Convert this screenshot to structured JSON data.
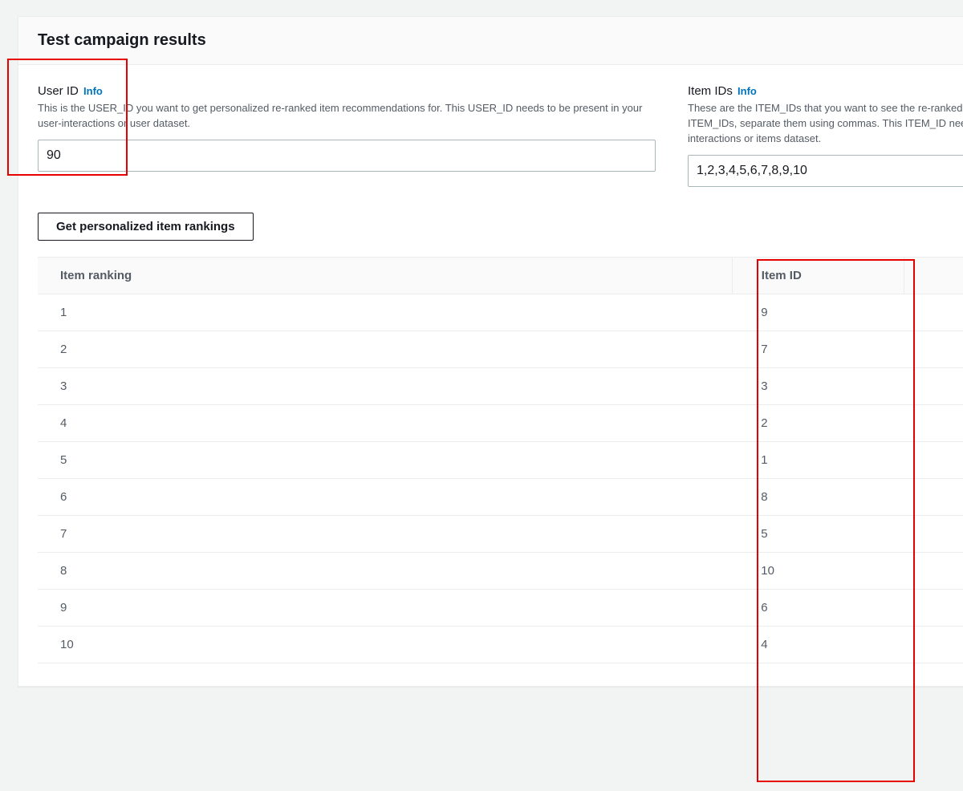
{
  "header": {
    "title": "Test campaign results"
  },
  "user_id": {
    "label": "User ID",
    "info": "Info",
    "help": "This is the USER_ID you want to get personalized re-ranked item recommendations for. This USER_ID needs to be present in your user-interactions or user dataset.",
    "value": "90"
  },
  "item_ids": {
    "label": "Item IDs",
    "info": "Info",
    "help": "These are the ITEM_IDs that you want to see the re-ranked results for. When entering the ITEM_IDs, separate them using commas. This ITEM_ID needs to be present in your interactions or items dataset.",
    "value": "1,2,3,4,5,6,7,8,9,10"
  },
  "action": {
    "label": "Get personalized item rankings"
  },
  "table": {
    "headers": {
      "rank": "Item ranking",
      "item_id": "Item ID"
    },
    "rows": [
      {
        "rank": "1",
        "item_id": "9"
      },
      {
        "rank": "2",
        "item_id": "7"
      },
      {
        "rank": "3",
        "item_id": "3"
      },
      {
        "rank": "4",
        "item_id": "2"
      },
      {
        "rank": "5",
        "item_id": "1"
      },
      {
        "rank": "6",
        "item_id": "8"
      },
      {
        "rank": "7",
        "item_id": "5"
      },
      {
        "rank": "8",
        "item_id": "10"
      },
      {
        "rank": "9",
        "item_id": "6"
      },
      {
        "rank": "10",
        "item_id": "4"
      }
    ]
  }
}
